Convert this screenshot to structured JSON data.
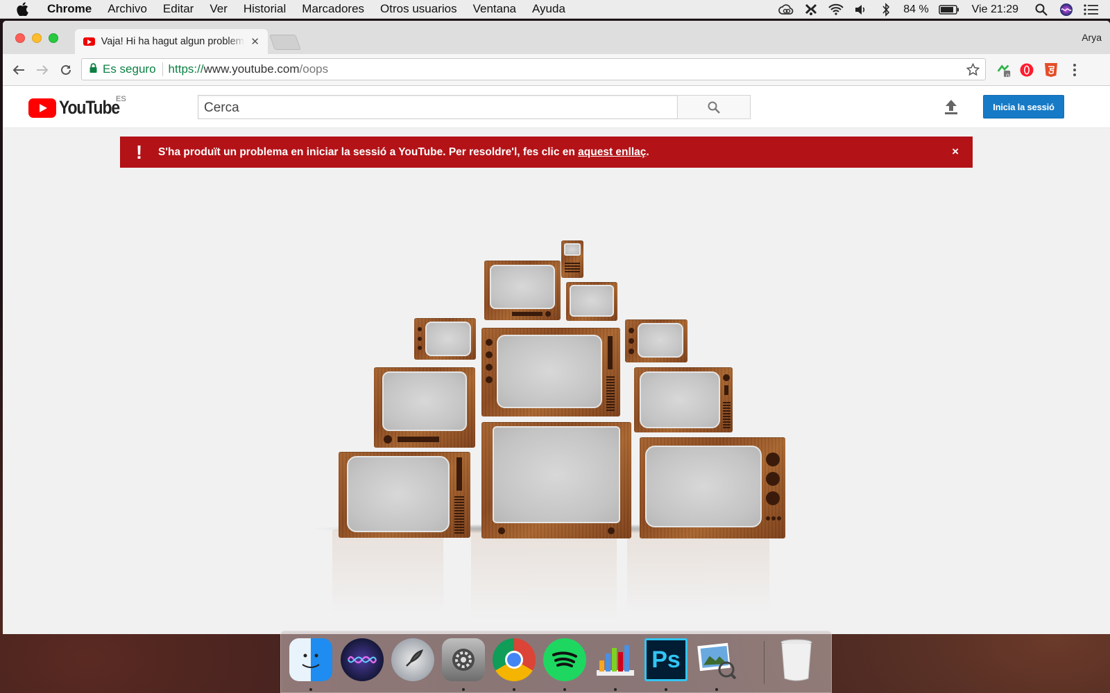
{
  "menubar": {
    "app_name": "Chrome",
    "items": [
      "Archivo",
      "Editar",
      "Ver",
      "Historial",
      "Marcadores",
      "Otros usuarios",
      "Ventana",
      "Ayuda"
    ],
    "battery": "84 %",
    "clock": "Vie 21:29",
    "status_icons": [
      "creative-cloud-icon",
      "app-icon",
      "wifi-icon",
      "volume-icon",
      "bluetooth-icon",
      "battery-icon",
      "spotlight-icon",
      "siri-icon",
      "notification-center-icon"
    ]
  },
  "browser": {
    "tab_title": "Vaja! Hi ha hagut algun problema",
    "profile_name": "Arya",
    "secure_label": "Es seguro",
    "url_scheme": "https://",
    "url_host": "www.youtube.com",
    "url_path": "/oops",
    "extensions": [
      "extension-icon",
      "opera-icon",
      "html5-icon"
    ],
    "extension_badge": "0"
  },
  "youtube": {
    "logo_text": "YouTube",
    "country_code": "ES",
    "search_placeholder": "Cerca",
    "signin_label": "Inicia la sessió",
    "alert": {
      "icon": "!",
      "message": "S'ha produït un problema en iniciar la sessió a YouTube. Per resoldre'l, fes clic en ",
      "link_text": "aquest enllaç",
      "suffix": ".",
      "close": "×"
    }
  },
  "dock": {
    "apps": [
      "finder",
      "siri",
      "launchpad",
      "system-preferences",
      "chrome",
      "spotify",
      "numbers",
      "photoshop",
      "preview",
      "trash"
    ],
    "photoshop_label": "Ps"
  },
  "colors": {
    "youtube_red": "#ff0000",
    "alert_red": "#b31217",
    "signin_blue": "#167ac6",
    "secure_green": "#0b8043"
  }
}
